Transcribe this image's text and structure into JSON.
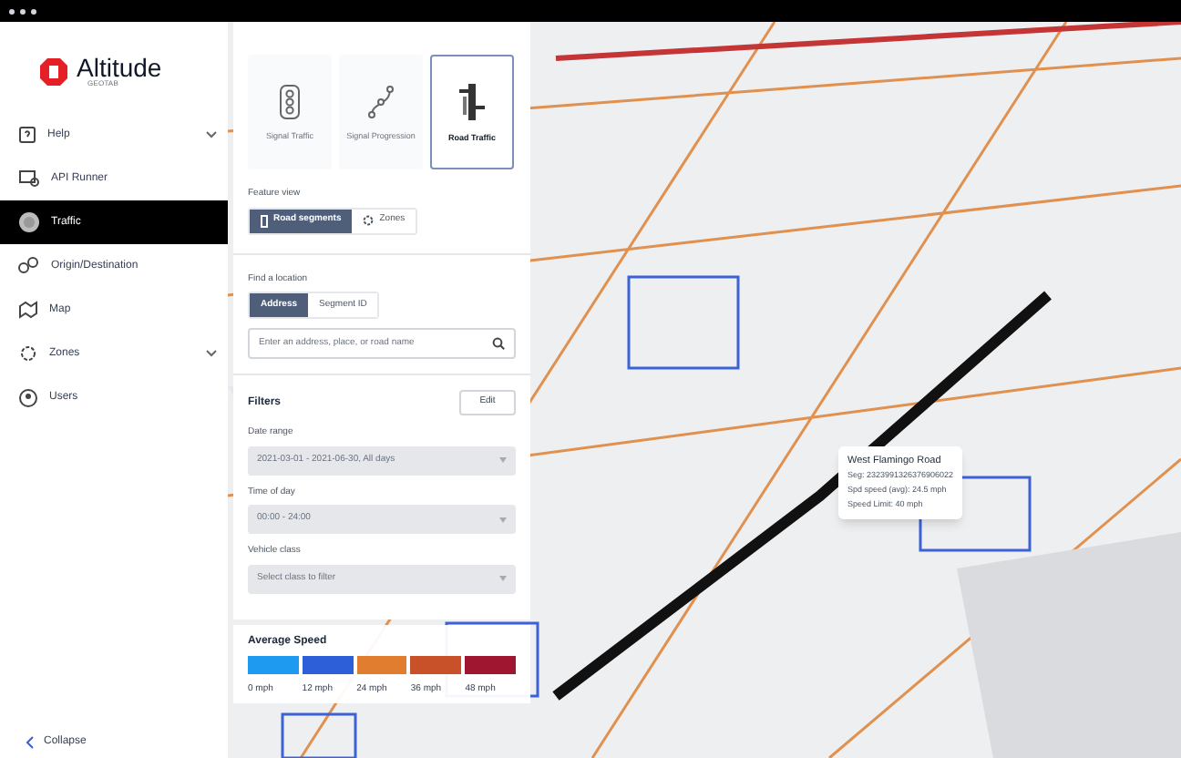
{
  "brand": {
    "name": "Altitude",
    "subtitle": "GEOTAB"
  },
  "sidebar": {
    "items": [
      {
        "label": "Help",
        "selected": false,
        "has_submenu": true
      },
      {
        "label": "API Runner",
        "selected": false,
        "has_submenu": false
      },
      {
        "label": "Traffic",
        "selected": true,
        "has_submenu": false
      },
      {
        "label": "Origin/Destination",
        "selected": false,
        "has_submenu": false
      },
      {
        "label": "Map",
        "selected": false,
        "has_submenu": false
      },
      {
        "label": "Zones",
        "selected": false,
        "has_submenu": true
      },
      {
        "label": "Users",
        "selected": false,
        "has_submenu": false
      }
    ],
    "collapse": "Collapse"
  },
  "panel": {
    "feature_types": [
      {
        "label": "Signal Traffic",
        "selected": false
      },
      {
        "label": "Signal Progression",
        "selected": false
      },
      {
        "label": "Road Traffic",
        "selected": true
      }
    ],
    "feature_view": {
      "label": "Feature view",
      "options": [
        {
          "label": "Road segments",
          "selected": true
        },
        {
          "label": "Zones",
          "selected": false
        }
      ]
    },
    "find_location": {
      "label": "Find a location",
      "options": [
        {
          "label": "Address",
          "selected": true
        },
        {
          "label": "Segment ID",
          "selected": false
        }
      ],
      "search": {
        "placeholder": "Enter an address, place, or road name"
      }
    },
    "filters": {
      "title": "Filters",
      "edit_button": "Edit",
      "fields": [
        {
          "label": "Date range",
          "value": "2021-03-01 - 2021-06-30, All days",
          "disabled": true
        },
        {
          "label": "Time of day",
          "value": "00:00 - 24:00",
          "disabled": true
        },
        {
          "label": "Vehicle class",
          "placeholder": "Select class to filter",
          "disabled": true
        }
      ]
    }
  },
  "legend": {
    "title": "Average Speed",
    "bins": [
      {
        "label": "0 mph",
        "color": "#1e9bf0"
      },
      {
        "label": "12 mph",
        "color": "#2d5fd8"
      },
      {
        "label": "24 mph",
        "color": "#e07d2e"
      },
      {
        "label": "36 mph",
        "color": "#c9512a"
      },
      {
        "label": "48 mph",
        "color": "#9e1630"
      }
    ]
  },
  "tooltip": {
    "title": "West Flamingo Road",
    "lines": [
      "Seg: 2323991326376906022",
      "Spd speed (avg): 24.5 mph",
      "Speed Limit: 40 mph"
    ]
  }
}
